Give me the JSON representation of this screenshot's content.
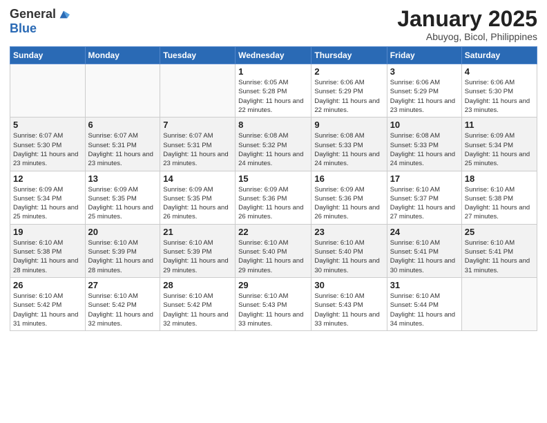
{
  "logo": {
    "general": "General",
    "blue": "Blue"
  },
  "header": {
    "month": "January 2025",
    "location": "Abuyog, Bicol, Philippines"
  },
  "weekdays": [
    "Sunday",
    "Monday",
    "Tuesday",
    "Wednesday",
    "Thursday",
    "Friday",
    "Saturday"
  ],
  "weeks": [
    [
      {
        "day": "",
        "empty": true
      },
      {
        "day": "",
        "empty": true
      },
      {
        "day": "",
        "empty": true
      },
      {
        "day": "1",
        "sunrise": "6:05 AM",
        "sunset": "5:28 PM",
        "daylight": "11 hours and 22 minutes."
      },
      {
        "day": "2",
        "sunrise": "6:06 AM",
        "sunset": "5:29 PM",
        "daylight": "11 hours and 22 minutes."
      },
      {
        "day": "3",
        "sunrise": "6:06 AM",
        "sunset": "5:29 PM",
        "daylight": "11 hours and 23 minutes."
      },
      {
        "day": "4",
        "sunrise": "6:06 AM",
        "sunset": "5:30 PM",
        "daylight": "11 hours and 23 minutes."
      }
    ],
    [
      {
        "day": "5",
        "sunrise": "6:07 AM",
        "sunset": "5:30 PM",
        "daylight": "11 hours and 23 minutes."
      },
      {
        "day": "6",
        "sunrise": "6:07 AM",
        "sunset": "5:31 PM",
        "daylight": "11 hours and 23 minutes."
      },
      {
        "day": "7",
        "sunrise": "6:07 AM",
        "sunset": "5:31 PM",
        "daylight": "11 hours and 23 minutes."
      },
      {
        "day": "8",
        "sunrise": "6:08 AM",
        "sunset": "5:32 PM",
        "daylight": "11 hours and 24 minutes."
      },
      {
        "day": "9",
        "sunrise": "6:08 AM",
        "sunset": "5:33 PM",
        "daylight": "11 hours and 24 minutes."
      },
      {
        "day": "10",
        "sunrise": "6:08 AM",
        "sunset": "5:33 PM",
        "daylight": "11 hours and 24 minutes."
      },
      {
        "day": "11",
        "sunrise": "6:09 AM",
        "sunset": "5:34 PM",
        "daylight": "11 hours and 25 minutes."
      }
    ],
    [
      {
        "day": "12",
        "sunrise": "6:09 AM",
        "sunset": "5:34 PM",
        "daylight": "11 hours and 25 minutes."
      },
      {
        "day": "13",
        "sunrise": "6:09 AM",
        "sunset": "5:35 PM",
        "daylight": "11 hours and 25 minutes."
      },
      {
        "day": "14",
        "sunrise": "6:09 AM",
        "sunset": "5:35 PM",
        "daylight": "11 hours and 26 minutes."
      },
      {
        "day": "15",
        "sunrise": "6:09 AM",
        "sunset": "5:36 PM",
        "daylight": "11 hours and 26 minutes."
      },
      {
        "day": "16",
        "sunrise": "6:09 AM",
        "sunset": "5:36 PM",
        "daylight": "11 hours and 26 minutes."
      },
      {
        "day": "17",
        "sunrise": "6:10 AM",
        "sunset": "5:37 PM",
        "daylight": "11 hours and 27 minutes."
      },
      {
        "day": "18",
        "sunrise": "6:10 AM",
        "sunset": "5:38 PM",
        "daylight": "11 hours and 27 minutes."
      }
    ],
    [
      {
        "day": "19",
        "sunrise": "6:10 AM",
        "sunset": "5:38 PM",
        "daylight": "11 hours and 28 minutes."
      },
      {
        "day": "20",
        "sunrise": "6:10 AM",
        "sunset": "5:39 PM",
        "daylight": "11 hours and 28 minutes."
      },
      {
        "day": "21",
        "sunrise": "6:10 AM",
        "sunset": "5:39 PM",
        "daylight": "11 hours and 29 minutes."
      },
      {
        "day": "22",
        "sunrise": "6:10 AM",
        "sunset": "5:40 PM",
        "daylight": "11 hours and 29 minutes."
      },
      {
        "day": "23",
        "sunrise": "6:10 AM",
        "sunset": "5:40 PM",
        "daylight": "11 hours and 30 minutes."
      },
      {
        "day": "24",
        "sunrise": "6:10 AM",
        "sunset": "5:41 PM",
        "daylight": "11 hours and 30 minutes."
      },
      {
        "day": "25",
        "sunrise": "6:10 AM",
        "sunset": "5:41 PM",
        "daylight": "11 hours and 31 minutes."
      }
    ],
    [
      {
        "day": "26",
        "sunrise": "6:10 AM",
        "sunset": "5:42 PM",
        "daylight": "11 hours and 31 minutes."
      },
      {
        "day": "27",
        "sunrise": "6:10 AM",
        "sunset": "5:42 PM",
        "daylight": "11 hours and 32 minutes."
      },
      {
        "day": "28",
        "sunrise": "6:10 AM",
        "sunset": "5:42 PM",
        "daylight": "11 hours and 32 minutes."
      },
      {
        "day": "29",
        "sunrise": "6:10 AM",
        "sunset": "5:43 PM",
        "daylight": "11 hours and 33 minutes."
      },
      {
        "day": "30",
        "sunrise": "6:10 AM",
        "sunset": "5:43 PM",
        "daylight": "11 hours and 33 minutes."
      },
      {
        "day": "31",
        "sunrise": "6:10 AM",
        "sunset": "5:44 PM",
        "daylight": "11 hours and 34 minutes."
      },
      {
        "day": "",
        "empty": true
      }
    ]
  ]
}
